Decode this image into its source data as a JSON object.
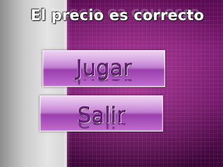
{
  "title": "El precio es correcto",
  "menu": {
    "play_label": "Jugar",
    "exit_label": "Salir"
  },
  "colors": {
    "background_purple": "#6a1363",
    "background_grey": "#d7d7d7",
    "button_fill": "#b45fc6",
    "button_text": "#6f2283",
    "title_text": "#ffffff"
  }
}
